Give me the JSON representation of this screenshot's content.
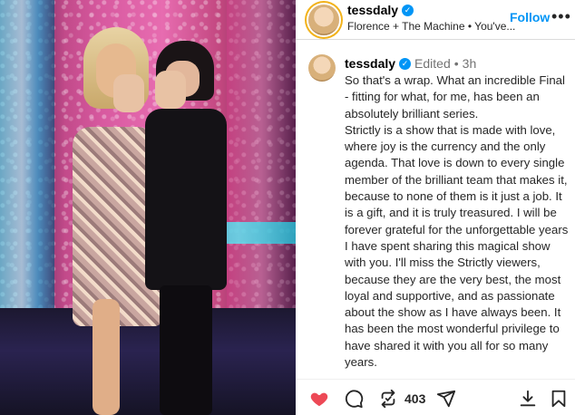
{
  "post": {
    "username": "tessdaly",
    "audio": "Florence + The Machine • You've...",
    "follow_label": "Follow",
    "more_label": "•••",
    "verified_mark": "✓"
  },
  "caption": {
    "username": "tessdaly",
    "edited_label": "Edited",
    "separator": "•",
    "time": "3h",
    "paragraphs": [
      "So that's a wrap. What an incredible Final - fitting for what, for me, has been an absolutely brilliant series.",
      "Strictly is a show that is made with love, where joy is the currency and the only agenda. That love is down to every single member of the brilliant team that makes it, because to none of them is it just a job. It is a gift, and it is truly treasured. I will be forever grateful for the unforgettable years I have spent sharing this magical show with you. I'll miss the Strictly viewers, because they are the very best, the most loyal and supportive, and as passionate about the show as I have always been. It has been the most wonderful privilege to have shared it with you all for so many years."
    ]
  },
  "actions": {
    "like_icon": "heart-filled",
    "comment_icon": "comment-bubble",
    "repost_icon": "repost-arrows",
    "repost_count": "403",
    "share_icon": "paper-plane",
    "download_icon": "download-arrow",
    "save_icon": "bookmark",
    "like_color": "#ed4956"
  },
  "colors": {
    "accent": "#0095f6",
    "text": "#262626",
    "muted": "#737373"
  }
}
